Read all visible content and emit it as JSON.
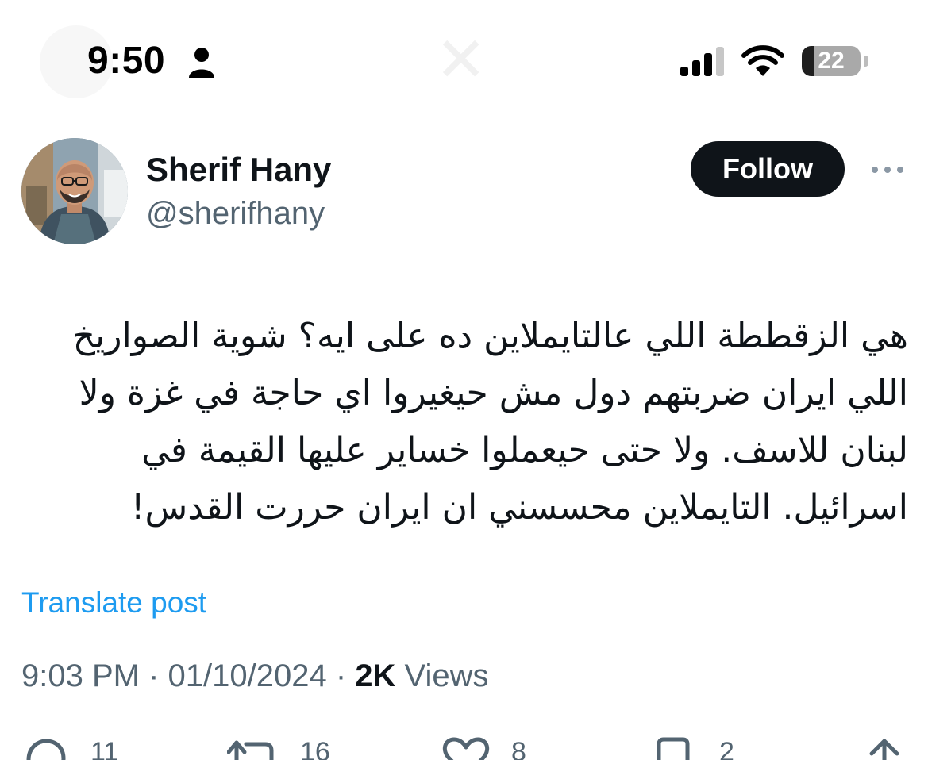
{
  "status_bar": {
    "time": "9:50",
    "battery_percent": 22,
    "icons": [
      "person-icon",
      "cellular-signal-icon",
      "wifi-icon",
      "battery-icon"
    ]
  },
  "author": {
    "display_name": "Sherif Hany",
    "handle": "@sherifhany",
    "avatar_icon": "profile-photo"
  },
  "follow_button": {
    "label": "Follow"
  },
  "post": {
    "text": "هي الزقططة اللي عالتايملاين ده على ايه؟ شوية الصواريخ اللي ايران ضربتهم دول مش حيغيروا اي حاجة في غزة ولا لبنان للاسف. ولا حتى حيعملوا خساير عليها القيمة في اسرائيل. التايملاين محسسني ان ايران حررت القدس!",
    "translate_label": "Translate post",
    "time": "9:03 PM",
    "separator": " · ",
    "date": "01/10/2024",
    "views_count": "2K",
    "views_label": " Views"
  },
  "actions": {
    "replies": "11",
    "reposts": "16",
    "likes": "8",
    "bookmarks": "2"
  },
  "colors": {
    "accent_link": "#1d9bf0",
    "text_primary": "#0f1419",
    "text_secondary": "#536471",
    "follow_bg": "#0f1419"
  }
}
